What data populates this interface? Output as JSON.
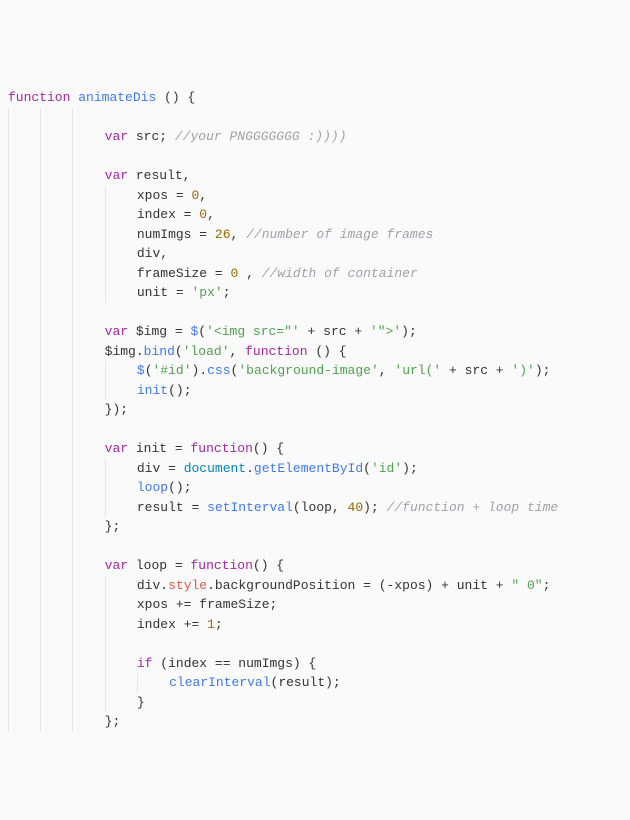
{
  "code": {
    "l1": {
      "kw": "function",
      "name": "animateDis",
      "rest": " () {"
    },
    "l2": "",
    "l3": {
      "kw": "var",
      "id": " src; ",
      "com": "//your PNGGGGGGG :))))"
    },
    "l4": "",
    "l5": {
      "kw": "var",
      "id": " result,"
    },
    "l6": {
      "id": "xpos = ",
      "num": "0",
      "rest": ","
    },
    "l7": {
      "id": "index = ",
      "num": "0",
      "rest": ","
    },
    "l8": {
      "id": "numImgs = ",
      "num": "26",
      "rest": ", ",
      "com": "//number of image frames"
    },
    "l9": {
      "id": "div,"
    },
    "l10": {
      "id": "frameSize = ",
      "num": "0",
      "rest": " , ",
      "com": "//width of container"
    },
    "l11": {
      "id": "unit = ",
      "str": "'px'",
      "rest": ";"
    },
    "l12": "",
    "l13": {
      "kw": "var",
      "id": " $img = ",
      "fn": "$",
      "p1": "(",
      "str1": "'<img src=\"'",
      "plus1": " + src + ",
      "str2": "'\">'",
      "p2": ");"
    },
    "l14": {
      "id": "$img.",
      "fn": "bind",
      "p1": "(",
      "str": "'load'",
      "mid": ", ",
      "kw": "function",
      "rest": " () {"
    },
    "l15": {
      "fn1": "$",
      "p1": "(",
      "str1": "'#id'",
      "p2": ").",
      "fn2": "css",
      "p3": "(",
      "str2": "'background-image'",
      "mid": ", ",
      "str3": "'url('",
      "plus": " + src + ",
      "str4": "')'",
      "p4": ");"
    },
    "l16": {
      "fn": "init",
      "rest": "();"
    },
    "l17": {
      "rest": "});"
    },
    "l18": "",
    "l19": {
      "kw": "var",
      "id": " init = ",
      "kw2": "function",
      "rest": "() {"
    },
    "l20": {
      "id": "div = ",
      "obj": "document",
      "dot": ".",
      "fn": "getElementById",
      "p1": "(",
      "str": "'id'",
      "p2": ");"
    },
    "l21": {
      "fn": "loop",
      "rest": "();"
    },
    "l22": {
      "id": "result = ",
      "fn": "setInterval",
      "p1": "(loop, ",
      "num": "40",
      "p2": "); ",
      "com": "//function + loop time"
    },
    "l23": {
      "rest": "};"
    },
    "l24": "",
    "l25": {
      "kw": "var",
      "id": " loop = ",
      "kw2": "function",
      "rest": "() {"
    },
    "l26": {
      "id": "div.",
      "prop": "style",
      "rest": ".backgroundPosition = (-xpos) + unit + ",
      "str": "\" 0\"",
      "end": ";"
    },
    "l27": {
      "id": "xpos += frameSize;"
    },
    "l28": {
      "id": "index += ",
      "num": "1",
      "rest": ";"
    },
    "l29": "",
    "l30": {
      "kw": "if",
      "rest": " (index == numImgs) {"
    },
    "l31": {
      "fn": "clearInterval",
      "rest": "(result);"
    },
    "l32": {
      "rest": "}"
    },
    "l33": {
      "rest": "};"
    }
  }
}
